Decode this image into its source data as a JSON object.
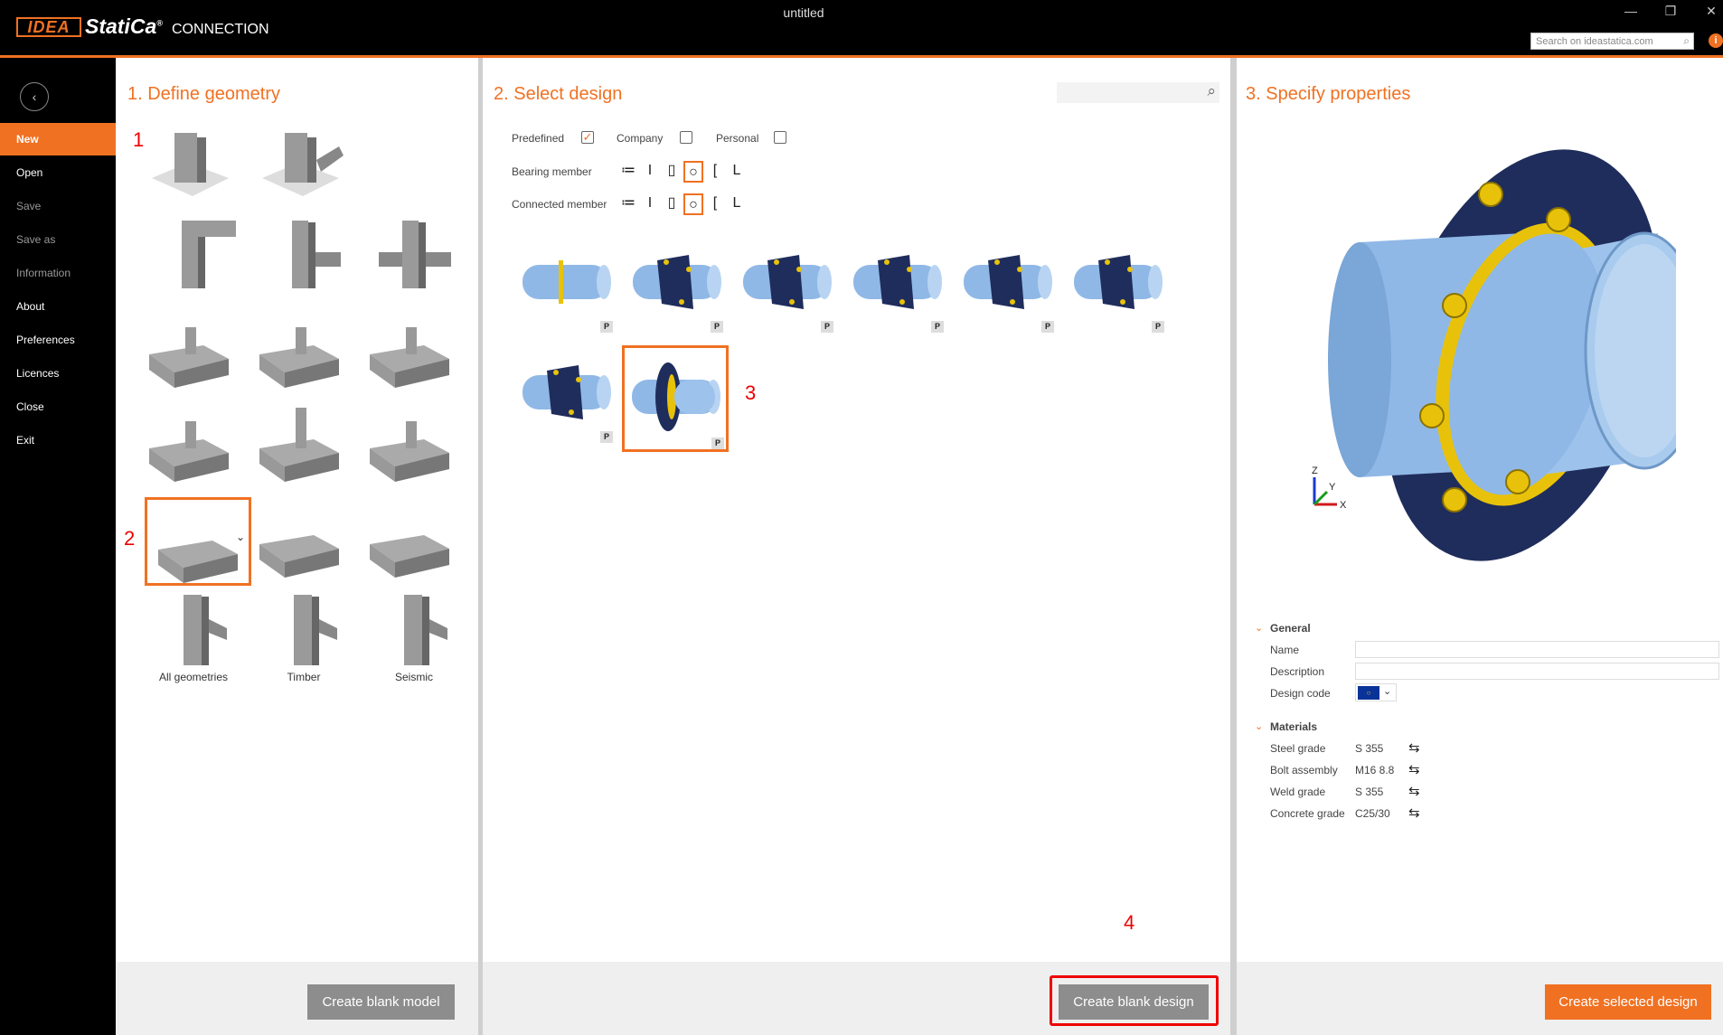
{
  "titlebar": {
    "logo_idea": "IDEA",
    "logo_statica": "StatiCa",
    "logo_reg": "®",
    "product": "CONNECTION",
    "window_title": "untitled",
    "minimize": "—",
    "restore": "❐",
    "close": "✕",
    "web_search_placeholder": "Search on ideastatica.com",
    "info": "i"
  },
  "sidebar": {
    "back": "‹",
    "items": [
      {
        "label": "New",
        "state": "active"
      },
      {
        "label": "Open",
        "state": "normal"
      },
      {
        "label": "Save",
        "state": "disabled"
      },
      {
        "label": "Save as",
        "state": "disabled"
      },
      {
        "label": "Information",
        "state": "disabled"
      },
      {
        "label": "About",
        "state": "normal"
      },
      {
        "label": "Preferences",
        "state": "normal"
      },
      {
        "label": "Licences",
        "state": "normal"
      },
      {
        "label": "Close",
        "state": "normal"
      },
      {
        "label": "Exit",
        "state": "normal"
      }
    ]
  },
  "geometry": {
    "title": "1. Define geometry",
    "labels": {
      "all": "All geometries",
      "timber": "Timber",
      "seismic": "Seismic"
    },
    "create_button": "Create blank model"
  },
  "design": {
    "title": "2. Select design",
    "filters": {
      "predefined": "Predefined",
      "predefined_checked": true,
      "company": "Company",
      "company_checked": false,
      "personal": "Personal",
      "personal_checked": false
    },
    "bearing_member": "Bearing member",
    "connected_member": "Connected member",
    "member_icons": [
      "≔",
      "I",
      "▯",
      "○",
      "[",
      "L"
    ],
    "selected_member_icon": "circle",
    "badge": "P",
    "design_count": 8,
    "selected_design": 8,
    "create_button": "Create blank design"
  },
  "properties": {
    "title": "3. Specify properties",
    "general": {
      "heading": "General",
      "name_label": "Name",
      "name_value": "",
      "description_label": "Description",
      "description_value": "",
      "design_code_label": "Design code",
      "design_code": "EU"
    },
    "materials": {
      "heading": "Materials",
      "rows": [
        {
          "label": "Steel grade",
          "value": "S 355"
        },
        {
          "label": "Bolt assembly",
          "value": "M16 8.8"
        },
        {
          "label": "Weld grade",
          "value": "S 355"
        },
        {
          "label": "Concrete grade",
          "value": "C25/30"
        }
      ]
    },
    "axes": {
      "z": "Z",
      "y": "Y",
      "x": "X"
    },
    "create_button": "Create selected design"
  },
  "annotations": [
    "1",
    "2",
    "3",
    "4"
  ],
  "colors": {
    "accent": "#f07122",
    "annotation": "#e00000",
    "pipe": "#8fb8e6",
    "plate": "#1f2d5c",
    "bolt": "#e8c20a"
  }
}
